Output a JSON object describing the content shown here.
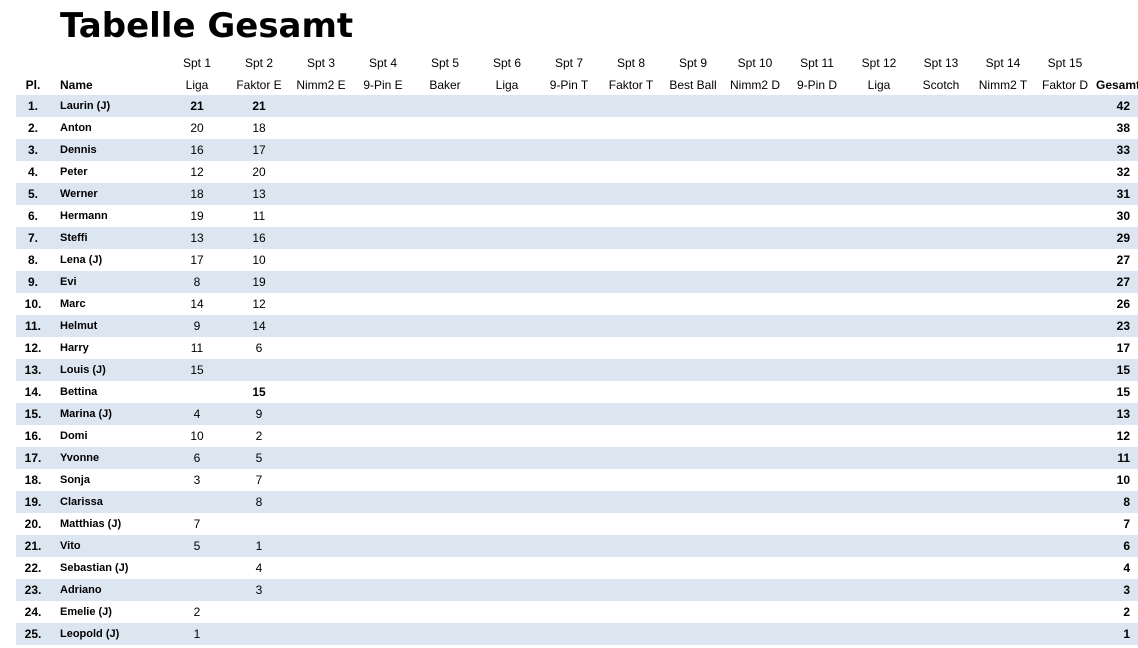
{
  "title": "Tabelle Gesamt",
  "header": {
    "pl": "Pl.",
    "name": "Name",
    "total": "Gesamt",
    "games": [
      {
        "no": "Spt 1",
        "type": "Liga"
      },
      {
        "no": "Spt 2",
        "type": "Faktor E"
      },
      {
        "no": "Spt 3",
        "type": "Nimm2 E"
      },
      {
        "no": "Spt 4",
        "type": "9-Pin E"
      },
      {
        "no": "Spt 5",
        "type": "Baker"
      },
      {
        "no": "Spt 6",
        "type": "Liga"
      },
      {
        "no": "Spt 7",
        "type": "9-Pin T"
      },
      {
        "no": "Spt 8",
        "type": "Faktor T"
      },
      {
        "no": "Spt 9",
        "type": "Best Ball"
      },
      {
        "no": "Spt 10",
        "type": "Nimm2 D"
      },
      {
        "no": "Spt 11",
        "type": "9-Pin D"
      },
      {
        "no": "Spt 12",
        "type": "Liga"
      },
      {
        "no": "Spt 13",
        "type": "Scotch"
      },
      {
        "no": "Spt 14",
        "type": "Nimm2 T"
      },
      {
        "no": "Spt 15",
        "type": "Faktor D"
      }
    ]
  },
  "rows": [
    {
      "pl": "1.",
      "name": "Laurin (J)",
      "s1": "21",
      "s2": "21",
      "total": "42",
      "bold1": true
    },
    {
      "pl": "2.",
      "name": "Anton",
      "s1": "20",
      "s2": "18",
      "total": "38"
    },
    {
      "pl": "3.",
      "name": "Dennis",
      "s1": "16",
      "s2": "17",
      "total": "33"
    },
    {
      "pl": "4.",
      "name": "Peter",
      "s1": "12",
      "s2": "20",
      "total": "32"
    },
    {
      "pl": "5.",
      "name": "Werner",
      "s1": "18",
      "s2": "13",
      "total": "31"
    },
    {
      "pl": "6.",
      "name": "Hermann",
      "s1": "19",
      "s2": "11",
      "total": "30"
    },
    {
      "pl": "7.",
      "name": "Steffi",
      "s1": "13",
      "s2": "16",
      "total": "29"
    },
    {
      "pl": "8.",
      "name": "Lena (J)",
      "s1": "17",
      "s2": "10",
      "total": "27"
    },
    {
      "pl": "9.",
      "name": "Evi",
      "s1": "8",
      "s2": "19",
      "total": "27"
    },
    {
      "pl": "10.",
      "name": "Marc",
      "s1": "14",
      "s2": "12",
      "total": "26"
    },
    {
      "pl": "11.",
      "name": "Helmut",
      "s1": "9",
      "s2": "14",
      "total": "23"
    },
    {
      "pl": "12.",
      "name": "Harry",
      "s1": "11",
      "s2": "6",
      "total": "17"
    },
    {
      "pl": "13.",
      "name": "Louis (J)",
      "s1": "15",
      "s2": "",
      "total": "15"
    },
    {
      "pl": "14.",
      "name": "Bettina",
      "s1": "",
      "s2": "15",
      "total": "15",
      "bold2": true
    },
    {
      "pl": "15.",
      "name": "Marina (J)",
      "s1": "4",
      "s2": "9",
      "total": "13"
    },
    {
      "pl": "16.",
      "name": "Domi",
      "s1": "10",
      "s2": "2",
      "total": "12"
    },
    {
      "pl": "17.",
      "name": "Yvonne",
      "s1": "6",
      "s2": "5",
      "total": "11"
    },
    {
      "pl": "18.",
      "name": "Sonja",
      "s1": "3",
      "s2": "7",
      "total": "10"
    },
    {
      "pl": "19.",
      "name": "Clarissa",
      "s1": "",
      "s2": "8",
      "total": "8"
    },
    {
      "pl": "20.",
      "name": "Matthias (J)",
      "s1": "7",
      "s2": "",
      "total": "7"
    },
    {
      "pl": "21.",
      "name": "Vito",
      "s1": "5",
      "s2": "1",
      "total": "6"
    },
    {
      "pl": "22.",
      "name": "Sebastian (J)",
      "s1": "",
      "s2": "4",
      "total": "4"
    },
    {
      "pl": "23.",
      "name": "Adriano",
      "s1": "",
      "s2": "3",
      "total": "3"
    },
    {
      "pl": "24.",
      "name": "Emelie (J)",
      "s1": "2",
      "s2": "",
      "total": "2"
    },
    {
      "pl": "25.",
      "name": "Leopold (J)",
      "s1": "1",
      "s2": "",
      "total": "1"
    }
  ],
  "colors": {
    "stripe": "#dce6f1",
    "background": "#ffffff",
    "text": "#000000"
  }
}
